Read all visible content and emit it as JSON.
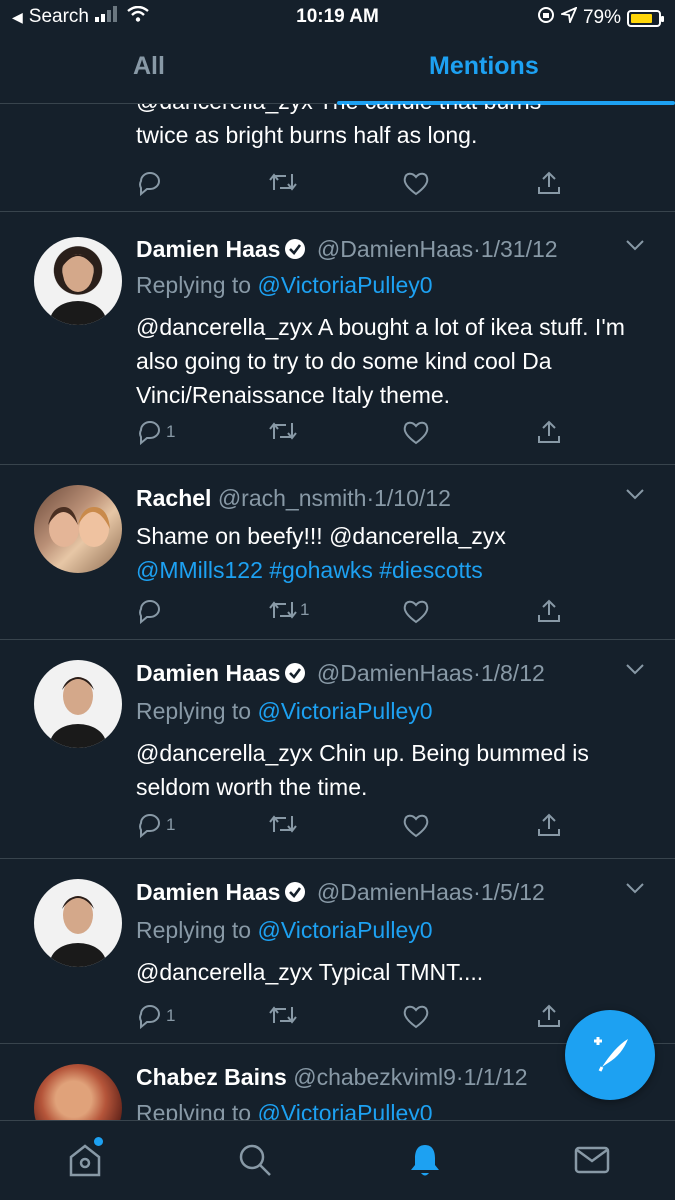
{
  "status_bar": {
    "back_label": "Search",
    "time": "10:19 AM",
    "battery": "79%",
    "battery_fraction": 0.79,
    "battery_color": "#ffd60a"
  },
  "tabs": [
    {
      "label": "All"
    },
    {
      "label": "Mentions",
      "active": true
    }
  ],
  "accent": "#1da1f2",
  "tweets": [
    {
      "text": "@dancerella_zyx The candle that burns twice as bright burns half as long.",
      "text_line1": "@dancerella_zyx The candle that burns",
      "text_line2": "twice as bright burns half as long."
    },
    {
      "name": "Damien Haas",
      "verified": true,
      "handle": "@DamienHaas",
      "sep": "·",
      "date": "1/31/12",
      "replying_prefix": "Replying to",
      "replying_to": "@VictoriaPulley0",
      "text": "@dancerella_zyx A bought a lot of ikea stuff. I'm also going to try to do some kind cool Da Vinci/Renaissance Italy theme.",
      "reply_count": "1",
      "retweet_count": ""
    },
    {
      "name": "Rachel",
      "verified": false,
      "handle": "@rach_nsmith",
      "sep": "·",
      "date": "1/10/12",
      "text_plain": "Shame on beefy!!! @dancerella_zyx",
      "text_links": "@MMills122 #gohawks #diescotts",
      "reply_count": "",
      "retweet_count": "1"
    },
    {
      "name": "Damien Haas",
      "verified": true,
      "handle": "@DamienHaas",
      "sep": "·",
      "date": "1/8/12",
      "replying_prefix": "Replying to",
      "replying_to": "@VictoriaPulley0",
      "text": "@dancerella_zyx Chin up. Being bummed is seldom worth the time.",
      "reply_count": "1",
      "retweet_count": ""
    },
    {
      "name": "Damien Haas",
      "verified": true,
      "handle": "@DamienHaas",
      "sep": "·",
      "date": "1/5/12",
      "replying_prefix": "Replying to",
      "replying_to": "@VictoriaPulley0",
      "text": "@dancerella_zyx Typical TMNT....",
      "reply_count": "1",
      "retweet_count": ""
    },
    {
      "name": "Chabez Bains",
      "verified": false,
      "handle": "@chabezkviml9",
      "sep": "·",
      "date": "1/1/12",
      "replying_prefix": "Replying to",
      "replying_to": "@VictoriaPulley0"
    }
  ],
  "icons": [
    "back-arrow-icon",
    "signal-icon",
    "wifi-icon",
    "lock-rotation-icon",
    "location-icon",
    "battery-icon",
    "reply-icon",
    "retweet-icon",
    "like-icon",
    "share-icon",
    "chevron-down-icon",
    "verified-badge-icon",
    "compose-tweet-icon",
    "home-icon",
    "search-icon",
    "notifications-icon",
    "messages-icon"
  ]
}
